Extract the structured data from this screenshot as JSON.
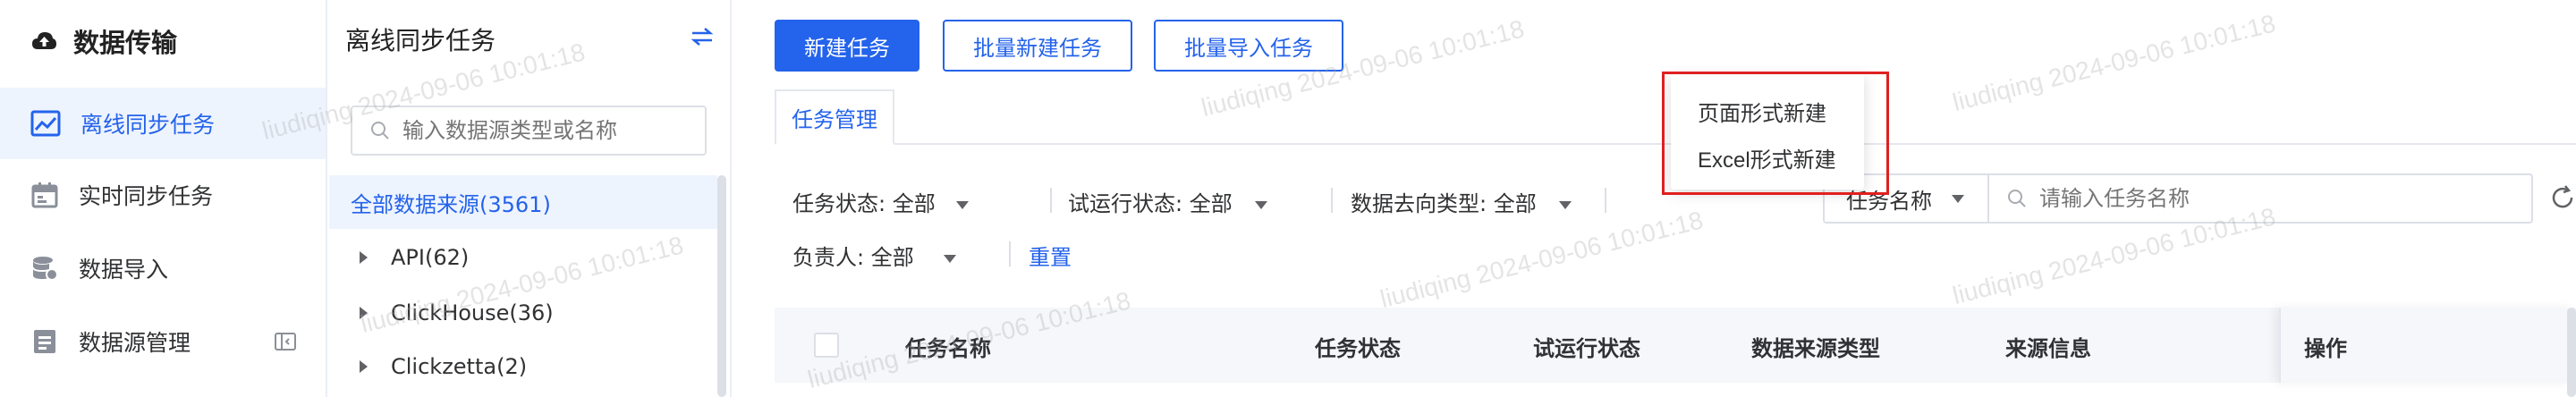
{
  "nav": {
    "brand": "数据传输",
    "items": [
      {
        "label": "离线同步任务",
        "icon": "chart-area-icon",
        "active": true
      },
      {
        "label": "实时同步任务",
        "icon": "calendar-icon",
        "active": false
      },
      {
        "label": "数据导入",
        "icon": "database-icon",
        "active": false
      },
      {
        "label": "数据源管理",
        "icon": "list-doc-icon",
        "active": false
      }
    ]
  },
  "tree": {
    "title": "离线同步任务",
    "search_placeholder": "输入数据源类型或名称",
    "all_label": "全部数据来源(3561)",
    "nodes": [
      "API(62)",
      "ClickHouse(36)",
      "Clickzetta(2)"
    ]
  },
  "toolbar": {
    "new_task": "新建任务",
    "batch_new": "批量新建任务",
    "batch_import": "批量导入任务"
  },
  "dropdown": {
    "items": [
      "页面形式新建",
      "Excel形式新建"
    ]
  },
  "tabs": [
    "任务管理"
  ],
  "filters": {
    "status_label": "任务状态: 全部",
    "trial_label": "试运行状态: 全部",
    "dest_label": "数据去向类型: 全部",
    "owner_label": "负责人: 全部",
    "reset": "重置",
    "name_select": "任务名称",
    "name_placeholder": "请输入任务名称"
  },
  "table": {
    "columns": [
      "任务名称",
      "任务状态",
      "试运行状态",
      "数据来源类型",
      "来源信息",
      "操作"
    ]
  },
  "watermark": "liudiqing 2024-09-06 10:01:18",
  "colors": {
    "accent": "#2463eb",
    "highlight": "#e02020",
    "active_bg": "#eef4fe"
  }
}
